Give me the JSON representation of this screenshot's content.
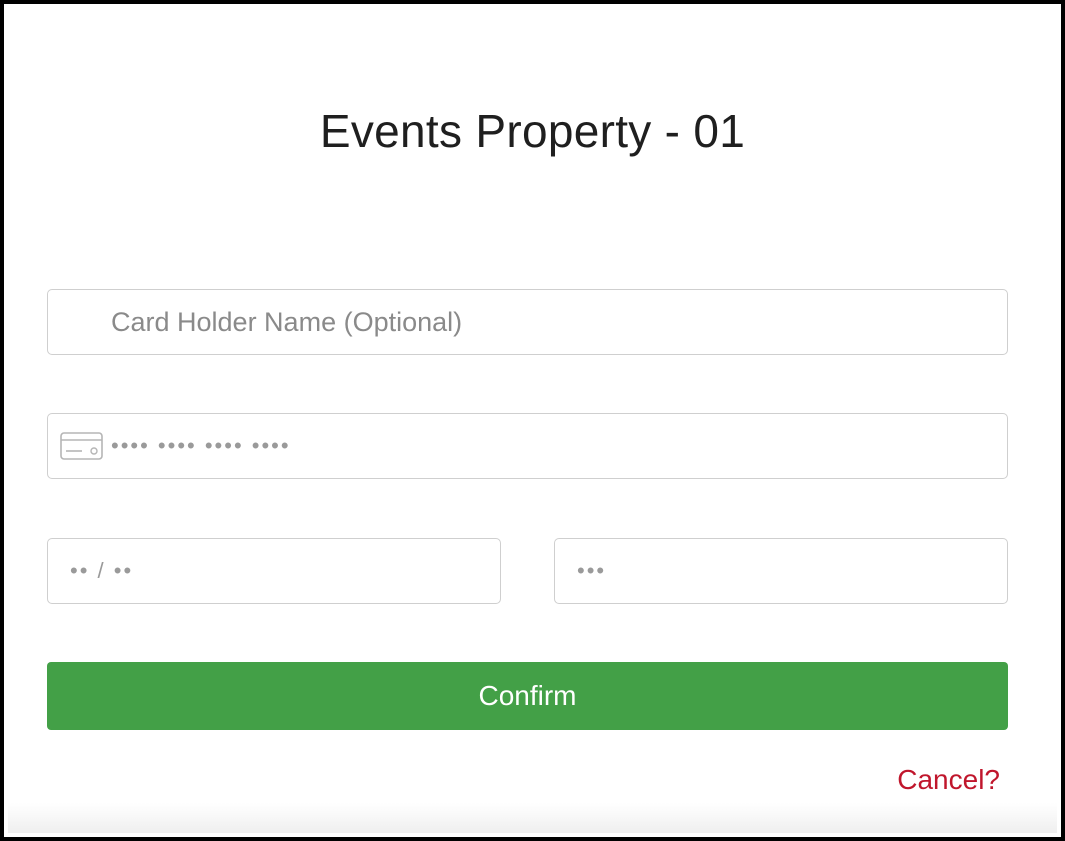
{
  "header": {
    "title": "Events Property - 01"
  },
  "form": {
    "card_holder": {
      "placeholder": "Card Holder Name (Optional)",
      "value": ""
    },
    "card_number": {
      "placeholder": "•••• •••• •••• ••••",
      "value": "",
      "icon": "credit-card-icon"
    },
    "expiry": {
      "placeholder": "•• / ••",
      "value": ""
    },
    "cvc": {
      "placeholder": "•••",
      "value": ""
    },
    "confirm_label": "Confirm",
    "cancel_label": "Cancel?"
  },
  "colors": {
    "confirm_bg": "#43a047",
    "cancel_text": "#c0162c",
    "title_text": "#1f1f1f",
    "field_border": "#cfcfcf"
  }
}
